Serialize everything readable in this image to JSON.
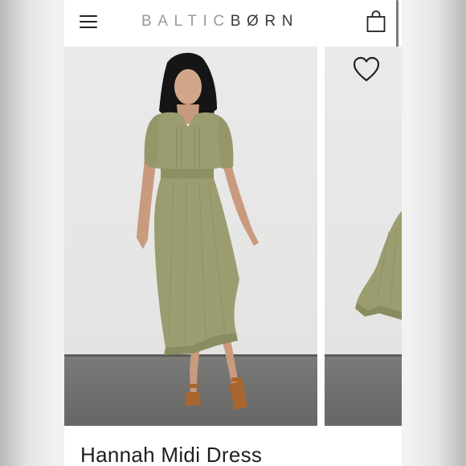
{
  "brand": {
    "part1": "BALTIC",
    "part2": "BØRN"
  },
  "header": {
    "menu_icon": "hamburger-menu-icon",
    "bag_icon": "shopping-bag-icon"
  },
  "gallery": {
    "wishlist_icon": "heart-icon",
    "images": [
      {
        "subject": "model wearing olive midi dress with brown heeled sandals"
      },
      {
        "subject": "partial view of ruffled olive dress hem"
      }
    ]
  },
  "product": {
    "name": "Hannah Midi Dress"
  },
  "colors": {
    "dress": "#9b9d70",
    "sandals": "#a9652e",
    "wall": "#e6e6e4",
    "floor": "#737371",
    "text": "#1e1e1e"
  }
}
